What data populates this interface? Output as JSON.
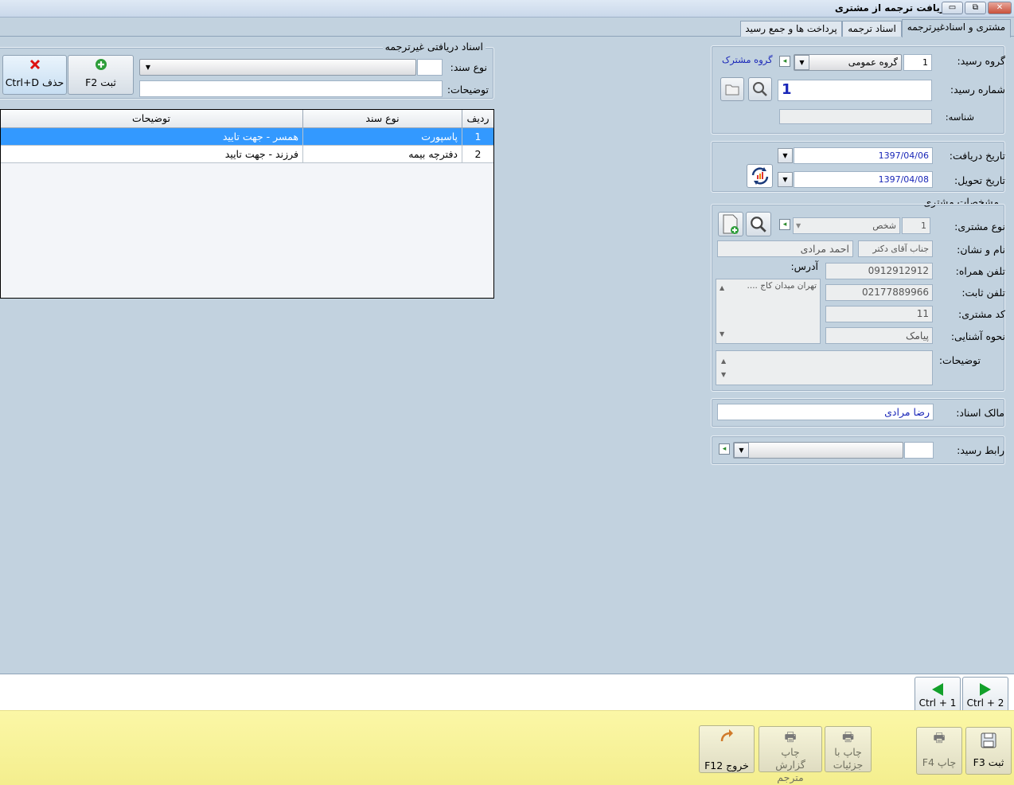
{
  "window": {
    "title": "دریافت ترجمه از مشتری",
    "minimize_glyph": "▭",
    "restore_glyph": "⧉",
    "close_glyph": "✕"
  },
  "tabs": [
    {
      "label": "مشتری و اسنادغیرترجمه",
      "active": true
    },
    {
      "label": "اسناد ترجمه",
      "active": false
    },
    {
      "label": "پرداخت ها و جمع رسید",
      "active": false
    }
  ],
  "receipt": {
    "group_label": "گروه رسید:",
    "group_code": "1",
    "group_value": "گروه عمومی",
    "customer_group_link": "گروه مشترک",
    "number_label": "شماره رسید:",
    "number_value": "1",
    "id_label": "شناسه:",
    "id_value": ""
  },
  "dates": {
    "receive_label": "تاریخ دریافت:",
    "receive_value": "1397/04/06",
    "delivery_label": "تاریخ تحویل:",
    "delivery_value": "1397/04/08"
  },
  "customer": {
    "section_title": "مشخصات مشتری",
    "type_label": "نوع مشتری:",
    "type_code": "1",
    "type_value": "شخص",
    "name_label": "نام و نشان:",
    "title_value": "جناب آقای دکتر",
    "name_value": "احمد مرادی",
    "address_label": "آدرس:",
    "address_value": "تهران میدان کاج ....",
    "mobile_label": "تلفن همراه:",
    "mobile_value": "0912912912",
    "phone_label": "تلفن ثابت:",
    "phone_value": "02177889966",
    "code_label": "کد مشتری:",
    "code_value": "11",
    "referral_label": "نحوه آشنایی:",
    "referral_value": "پیامک",
    "notes_label": "توضیحات:",
    "notes_value": ""
  },
  "owner": {
    "label": "مالک اسناد:",
    "value": "رضا مرادی"
  },
  "broker": {
    "label": "رابط رسید:",
    "value": ""
  },
  "nontrans": {
    "section_title": "اسناد دریافتی غیرترجمه",
    "doc_type_label": "نوع سند:",
    "doc_type_value": "",
    "notes_label": "توضیحات:",
    "notes_value": "",
    "save_button": "ثبت  F2",
    "delete_button": "حذف Ctrl+D"
  },
  "grid": {
    "columns": [
      "ردیف",
      "نوع سند",
      "توضیحات"
    ],
    "rows": [
      {
        "index": "1",
        "doc_type": "پاسپورت",
        "notes": "همسر - جهت تایید",
        "selected": true
      },
      {
        "index": "2",
        "doc_type": "دفترچه بیمه",
        "notes": "فرزند - جهت تایید",
        "selected": false
      }
    ]
  },
  "nav": {
    "next": "Ctrl + 2",
    "prev": "Ctrl + 1"
  },
  "footer_buttons": {
    "save": "ثبت  F3",
    "print": "چاپ  F4",
    "print_details": "چاپ با جزئیات",
    "print_translator_report": "چاپ گزارش مترجم",
    "exit": "خروج  F12"
  }
}
